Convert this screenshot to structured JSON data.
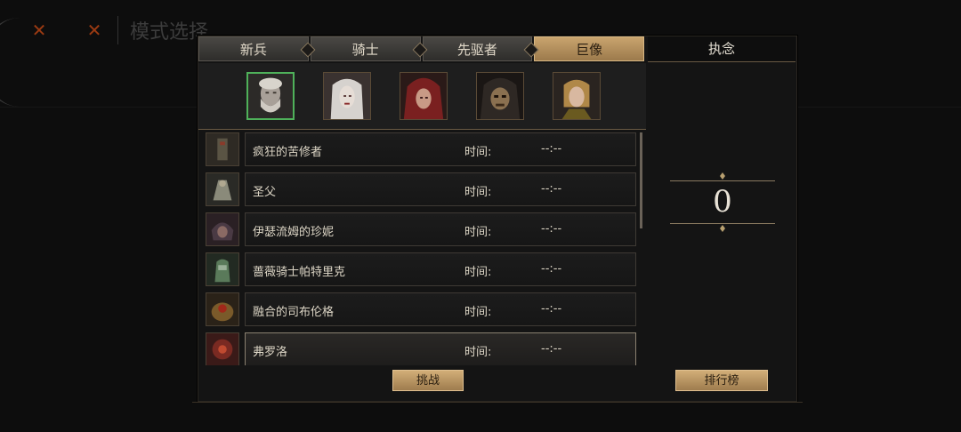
{
  "background": {
    "title": "模式选择",
    "icons": [
      "close-x-icon-orange",
      "close-x-icon-dim"
    ],
    "faint_text_1": "",
    "faint_text_2": ""
  },
  "tabs": [
    {
      "label": "新兵",
      "active": false
    },
    {
      "label": "骑士",
      "active": false
    },
    {
      "label": "先驱者",
      "active": false
    },
    {
      "label": "巨像",
      "active": true
    }
  ],
  "right_panel": {
    "title": "执念",
    "score": "0",
    "leaderboard_label": "排行榜"
  },
  "portraits": [
    {
      "name": "old-man-portrait",
      "selected": true
    },
    {
      "name": "silver-hair-woman-portrait",
      "selected": false
    },
    {
      "name": "red-hood-portrait",
      "selected": false
    },
    {
      "name": "masked-figure-portrait",
      "selected": false
    },
    {
      "name": "blonde-figure-portrait",
      "selected": false
    }
  ],
  "bosses": [
    {
      "name": "疯狂的苦修者",
      "time_label": "时间:",
      "time_value": "--:--",
      "selected": false
    },
    {
      "name": "圣父",
      "time_label": "时间:",
      "time_value": "--:--",
      "selected": false
    },
    {
      "name": "伊瑟流姆的珍妮",
      "time_label": "时间:",
      "time_value": "--:--",
      "selected": false
    },
    {
      "name": "蔷薇骑士帕特里克",
      "time_label": "时间:",
      "time_value": "--:--",
      "selected": false
    },
    {
      "name": "融合的司布伦格",
      "time_label": "时间:",
      "time_value": "--:--",
      "selected": false
    },
    {
      "name": "弗罗洛",
      "time_label": "时间:",
      "time_value": "--:--",
      "selected": true
    }
  ],
  "challenge_label": "挑战",
  "colors": {
    "accent_gold": "#c9a46e",
    "selected_green": "#4fb15a",
    "panel_bg": "#141414"
  }
}
